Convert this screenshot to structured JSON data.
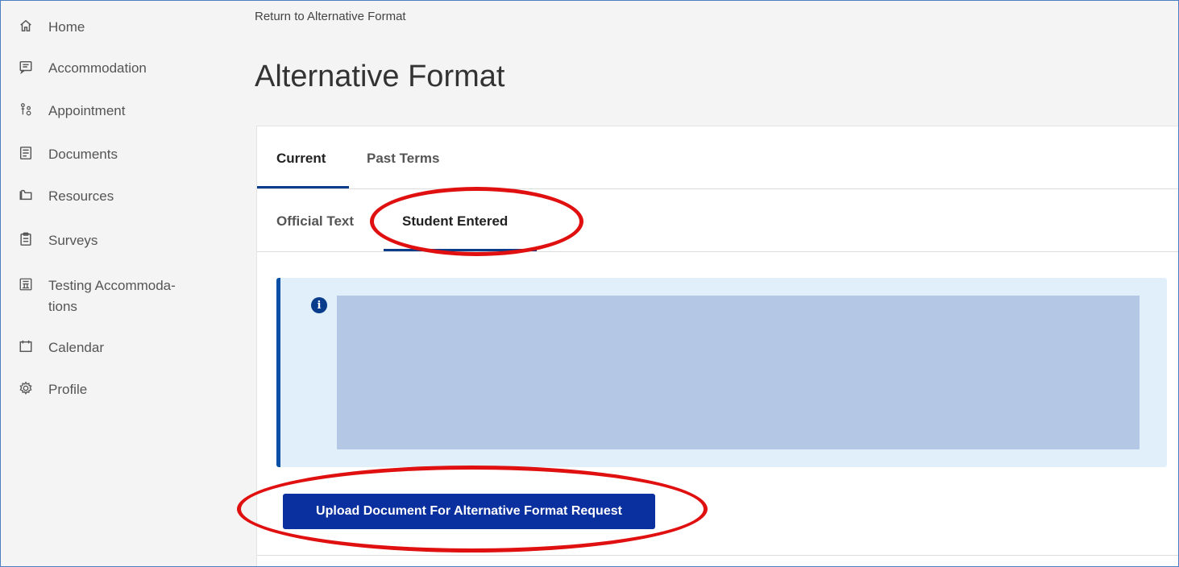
{
  "sidebar": {
    "items": [
      {
        "label": "Home",
        "icon": "home-icon"
      },
      {
        "label": "Accommodation",
        "icon": "message-icon"
      },
      {
        "label": "Appointment",
        "icon": "people-icon"
      },
      {
        "label": "Documents",
        "icon": "document-icon"
      },
      {
        "label": "Resources",
        "icon": "folder-icon"
      },
      {
        "label": "Surveys",
        "icon": "clipboard-icon"
      },
      {
        "label": "Testing Accommoda-",
        "label2": "tions",
        "icon": "testing-icon"
      },
      {
        "label": "Calendar",
        "icon": "calendar-icon"
      },
      {
        "label": "Profile",
        "icon": "gear-icon"
      }
    ]
  },
  "main": {
    "return_link": "Return to Alternative Format",
    "title": "Alternative Format",
    "tabs": [
      {
        "label": "Current",
        "active": true
      },
      {
        "label": "Past Terms",
        "active": false
      }
    ],
    "subtabs": [
      {
        "label": "Official Text",
        "active": false
      },
      {
        "label": "Student Entered",
        "active": true
      }
    ],
    "upload_button": "Upload Document For Alternative Format Request"
  },
  "colors": {
    "accent": "#0a2f9e",
    "info_bg": "#e1effb",
    "annotation": "#e01010"
  }
}
